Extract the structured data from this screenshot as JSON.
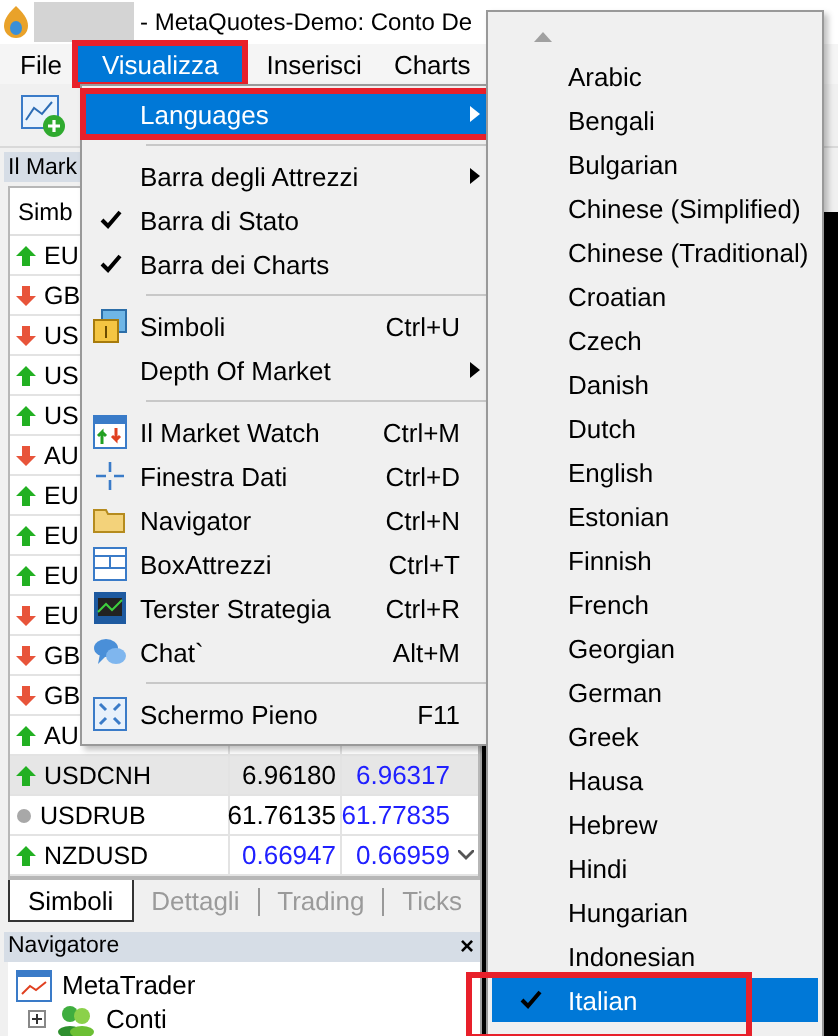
{
  "window": {
    "title": "- MetaQuotes-Demo: Conto De"
  },
  "menubar": [
    {
      "label": "File",
      "selected": false,
      "marked": false
    },
    {
      "label": "Visualizza",
      "selected": true,
      "marked": true
    },
    {
      "label": "Inserisci",
      "selected": false,
      "marked": false
    },
    {
      "label": "Charts",
      "selected": false,
      "marked": false
    }
  ],
  "market_watch": {
    "title": "Il Mark",
    "column_1": "Simb",
    "rows": [
      {
        "symbol": "EU",
        "kind": "up",
        "selected": false
      },
      {
        "symbol": "GB",
        "kind": "down",
        "selected": false
      },
      {
        "symbol": "US",
        "kind": "down",
        "selected": false
      },
      {
        "symbol": "US",
        "kind": "up",
        "selected": false
      },
      {
        "symbol": "US",
        "kind": "up",
        "selected": false
      },
      {
        "symbol": "AU",
        "kind": "down",
        "selected": false
      },
      {
        "symbol": "EU",
        "kind": "up",
        "selected": false
      },
      {
        "symbol": "EU",
        "kind": "up",
        "selected": false
      },
      {
        "symbol": "EU",
        "kind": "up",
        "selected": false
      },
      {
        "symbol": "EU",
        "kind": "down",
        "selected": false
      },
      {
        "symbol": "GB",
        "kind": "down",
        "selected": false
      },
      {
        "symbol": "GB",
        "kind": "down",
        "selected": false
      },
      {
        "symbol": "AU",
        "kind": "up",
        "selected": false
      },
      {
        "symbol": "USDCNH",
        "kind": "up",
        "selected": true,
        "bid": "6.96180",
        "bid_changed": false,
        "ask": "6.96317",
        "ask_changed": true
      },
      {
        "symbol": "USDRUB",
        "kind": "flat",
        "selected": false,
        "bid": "61.76135",
        "bid_changed": false,
        "ask": "61.77835",
        "ask_changed": true
      },
      {
        "symbol": "NZDUSD",
        "kind": "up",
        "selected": false,
        "bid": "0.66947",
        "bid_changed": true,
        "ask": "0.66959",
        "ask_changed": true
      }
    ],
    "tabs": [
      {
        "label": "Simboli",
        "selected": true
      },
      {
        "label": "Dettagli",
        "selected": false
      },
      {
        "label": "Trading",
        "selected": false
      },
      {
        "label": "Ticks",
        "selected": false
      }
    ]
  },
  "navigator": {
    "title": "Navigatore",
    "close": "×",
    "tree": [
      {
        "label": "MetaTrader",
        "expanded": true,
        "children": [
          {
            "label": "Conti",
            "expanded": false
          }
        ]
      }
    ]
  },
  "view_menu": [
    {
      "kind": "submenu",
      "label": "Languages",
      "selected": true,
      "marked": true
    },
    {
      "kind": "separator"
    },
    {
      "kind": "submenu",
      "label": "Barra degli Attrezzi",
      "selected": false,
      "marked": false
    },
    {
      "kind": "check",
      "label": "Barra di Stato",
      "checked": true,
      "selected": false,
      "marked": false
    },
    {
      "kind": "check",
      "label": "Barra dei Charts",
      "checked": true,
      "selected": false,
      "marked": false
    },
    {
      "kind": "separator"
    },
    {
      "kind": "command",
      "label": "Simboli",
      "shortcut": "Ctrl+U",
      "selected": false,
      "marked": false
    },
    {
      "kind": "submenu",
      "label": "Depth Of Market",
      "selected": false,
      "marked": false
    },
    {
      "kind": "separator"
    },
    {
      "kind": "command",
      "label": "Il Market Watch",
      "shortcut": "Ctrl+M",
      "selected": false,
      "marked": false
    },
    {
      "kind": "command",
      "label": "Finestra Dati",
      "shortcut": "Ctrl+D",
      "selected": false,
      "marked": false
    },
    {
      "kind": "command",
      "label": "Navigator",
      "shortcut": "Ctrl+N",
      "selected": false,
      "marked": false
    },
    {
      "kind": "command",
      "label": "BoxAttrezzi",
      "shortcut": "Ctrl+T",
      "selected": false,
      "marked": false
    },
    {
      "kind": "command",
      "label": "Terster Strategia",
      "shortcut": "Ctrl+R",
      "selected": false,
      "marked": false
    },
    {
      "kind": "command",
      "label": "Chat`",
      "shortcut": "Alt+M",
      "selected": false,
      "marked": false
    },
    {
      "kind": "separator"
    },
    {
      "kind": "command",
      "label": "Schermo Pieno",
      "shortcut": "F11",
      "selected": false,
      "marked": false
    }
  ],
  "languages_menu": [
    {
      "label": "Arabic",
      "checked": false,
      "selected": false,
      "marked": false
    },
    {
      "label": "Bengali",
      "checked": false,
      "selected": false,
      "marked": false
    },
    {
      "label": "Bulgarian",
      "checked": false,
      "selected": false,
      "marked": false
    },
    {
      "label": "Chinese (Simplified)",
      "checked": false,
      "selected": false,
      "marked": false
    },
    {
      "label": "Chinese (Traditional)",
      "checked": false,
      "selected": false,
      "marked": false
    },
    {
      "label": "Croatian",
      "checked": false,
      "selected": false,
      "marked": false
    },
    {
      "label": "Czech",
      "checked": false,
      "selected": false,
      "marked": false
    },
    {
      "label": "Danish",
      "checked": false,
      "selected": false,
      "marked": false
    },
    {
      "label": "Dutch",
      "checked": false,
      "selected": false,
      "marked": false
    },
    {
      "label": "English",
      "checked": false,
      "selected": false,
      "marked": false
    },
    {
      "label": "Estonian",
      "checked": false,
      "selected": false,
      "marked": false
    },
    {
      "label": "Finnish",
      "checked": false,
      "selected": false,
      "marked": false
    },
    {
      "label": "French",
      "checked": false,
      "selected": false,
      "marked": false
    },
    {
      "label": "Georgian",
      "checked": false,
      "selected": false,
      "marked": false
    },
    {
      "label": "German",
      "checked": false,
      "selected": false,
      "marked": false
    },
    {
      "label": "Greek",
      "checked": false,
      "selected": false,
      "marked": false
    },
    {
      "label": "Hausa",
      "checked": false,
      "selected": false,
      "marked": false
    },
    {
      "label": "Hebrew",
      "checked": false,
      "selected": false,
      "marked": false
    },
    {
      "label": "Hindi",
      "checked": false,
      "selected": false,
      "marked": false
    },
    {
      "label": "Hungarian",
      "checked": false,
      "selected": false,
      "marked": false
    },
    {
      "label": "Indonesian",
      "checked": false,
      "selected": false,
      "marked": false
    },
    {
      "label": "Italian",
      "checked": true,
      "selected": true,
      "marked": true
    }
  ]
}
